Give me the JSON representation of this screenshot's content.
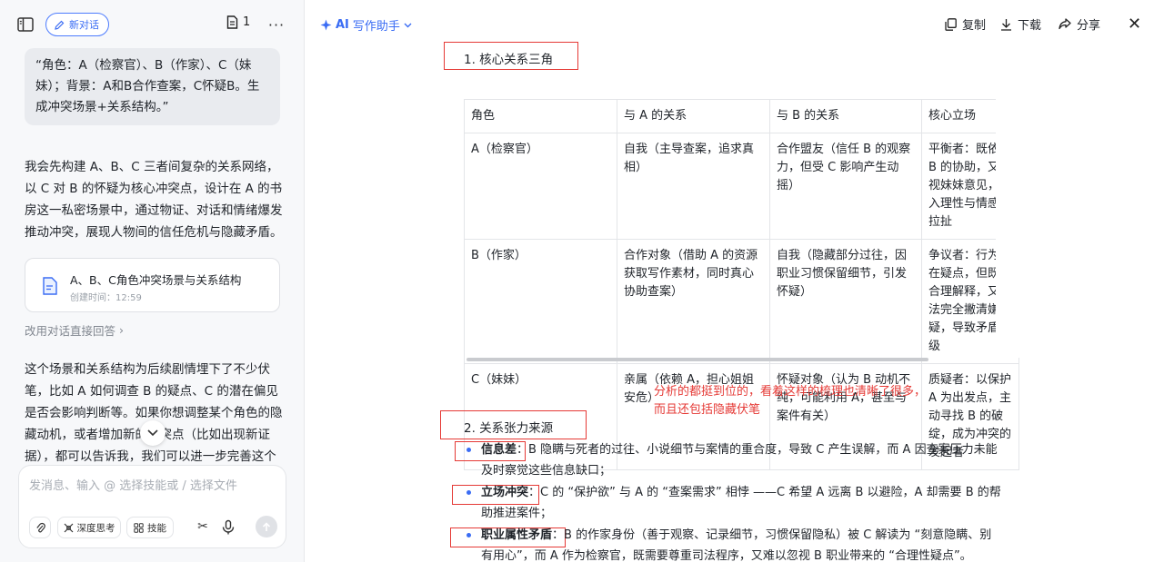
{
  "left_panel": {
    "new_chat_label": "新对话",
    "doc_count": "1",
    "user_message": "“角色：A（检察官）、B（作家）、C（妹妹）；背景：A和B合作查案，C怀疑B。生成冲突场景+关系结构。”",
    "reply_intro": "我会先构建 A、B、C 三者间复杂的关系网络，以 C 对 B 的怀疑为核心冲突点，设计在 A 的书房这一私密场景中，通过物证、对话和情绪爆发推动冲突，展现人物间的信任危机与隐藏矛盾。",
    "doc_card": {
      "title": "A、B、C角色冲突场景与关系结构",
      "created": "创建时间：12:59"
    },
    "switch_link": "改用对话直接回答",
    "reply_followup": "这个场景和关系结构为后续剧情埋下了不少伏笔，比如 A 如何调查 B 的疑点、C 的潜在偏见是否会影响判断等。如果你想调整某个角色的隐藏动机，或者增加新的冲突点（比如出现新证据），都可以告诉我，我们可以进一步完善这个",
    "composer": {
      "placeholder": "发消息、输入 @ 选择技能或 / 选择文件",
      "deep_think_label": "深度思考",
      "skills_label": "技能"
    }
  },
  "right_panel": {
    "assistant_title_ai": "AI",
    "assistant_title_rest": "写作助手",
    "actions": {
      "copy": "复制",
      "download": "下载",
      "share": "分享"
    },
    "section1_heading": "1. 核心关系三角",
    "table": {
      "headers": [
        "角色",
        "与 A 的关系",
        "与 B 的关系",
        "核心立场"
      ],
      "rows": [
        [
          "A（检察官）",
          "自我（主导查案，追求真相）",
          "合作盟友（信任 B 的观察力，但受 C 影响产生动摇）",
          "平衡者：既依赖 B 的协助，又重视妹妹意见，陷入理性与情感的拉扯"
        ],
        [
          "B（作家）",
          "合作对象（借助 A 的资源获取写作素材，同时真心协助查案）",
          "自我（隐藏部分过往，因职业习惯保留细节，引发怀疑）",
          "争议者：行为存在疑点，但既有合理解释，又无法完全撇清嫌疑，导致矛盾升级"
        ],
        [
          "C（妹妹）",
          "亲属（依赖 A，担心姐姐安危）",
          "怀疑对象（认为 B 动机不纯，可能利用 A，甚至与案件有关）",
          "质疑者：以保护 A 为出发点，主动寻找 B 的破绽，成为冲突的发起者"
        ]
      ]
    },
    "annotation_line1": "分析的都挺到位的，看着这样的梳理也清晰了很多，",
    "annotation_line2": "而且还包括隐藏伏笔",
    "section2_heading": "2. 关系张力来源",
    "bullets": [
      {
        "term": "信息差",
        "text": "：B 隐瞒与死者的过往、小说细节与案情的重合度，导致 C 产生误解，而 A 因查案压力未能及时察觉这些信息缺口；"
      },
      {
        "term": "立场冲突",
        "text": "：C 的 “保护欲” 与 A 的 “查案需求” 相悖 ——C 希望 A 远离 B 以避险，A 却需要 B 的帮助推进案件；"
      },
      {
        "term": "职业属性矛盾",
        "text": "：B 的作家身份（善于观察、记录细节，习惯保留隐私）被 C 解读为 “刻意隐瞒、别有用心”，而 A 作为检察官，既需要尊重司法程序，又难以忽视 B 职业带来的 “合理性疑点”。"
      }
    ]
  }
}
